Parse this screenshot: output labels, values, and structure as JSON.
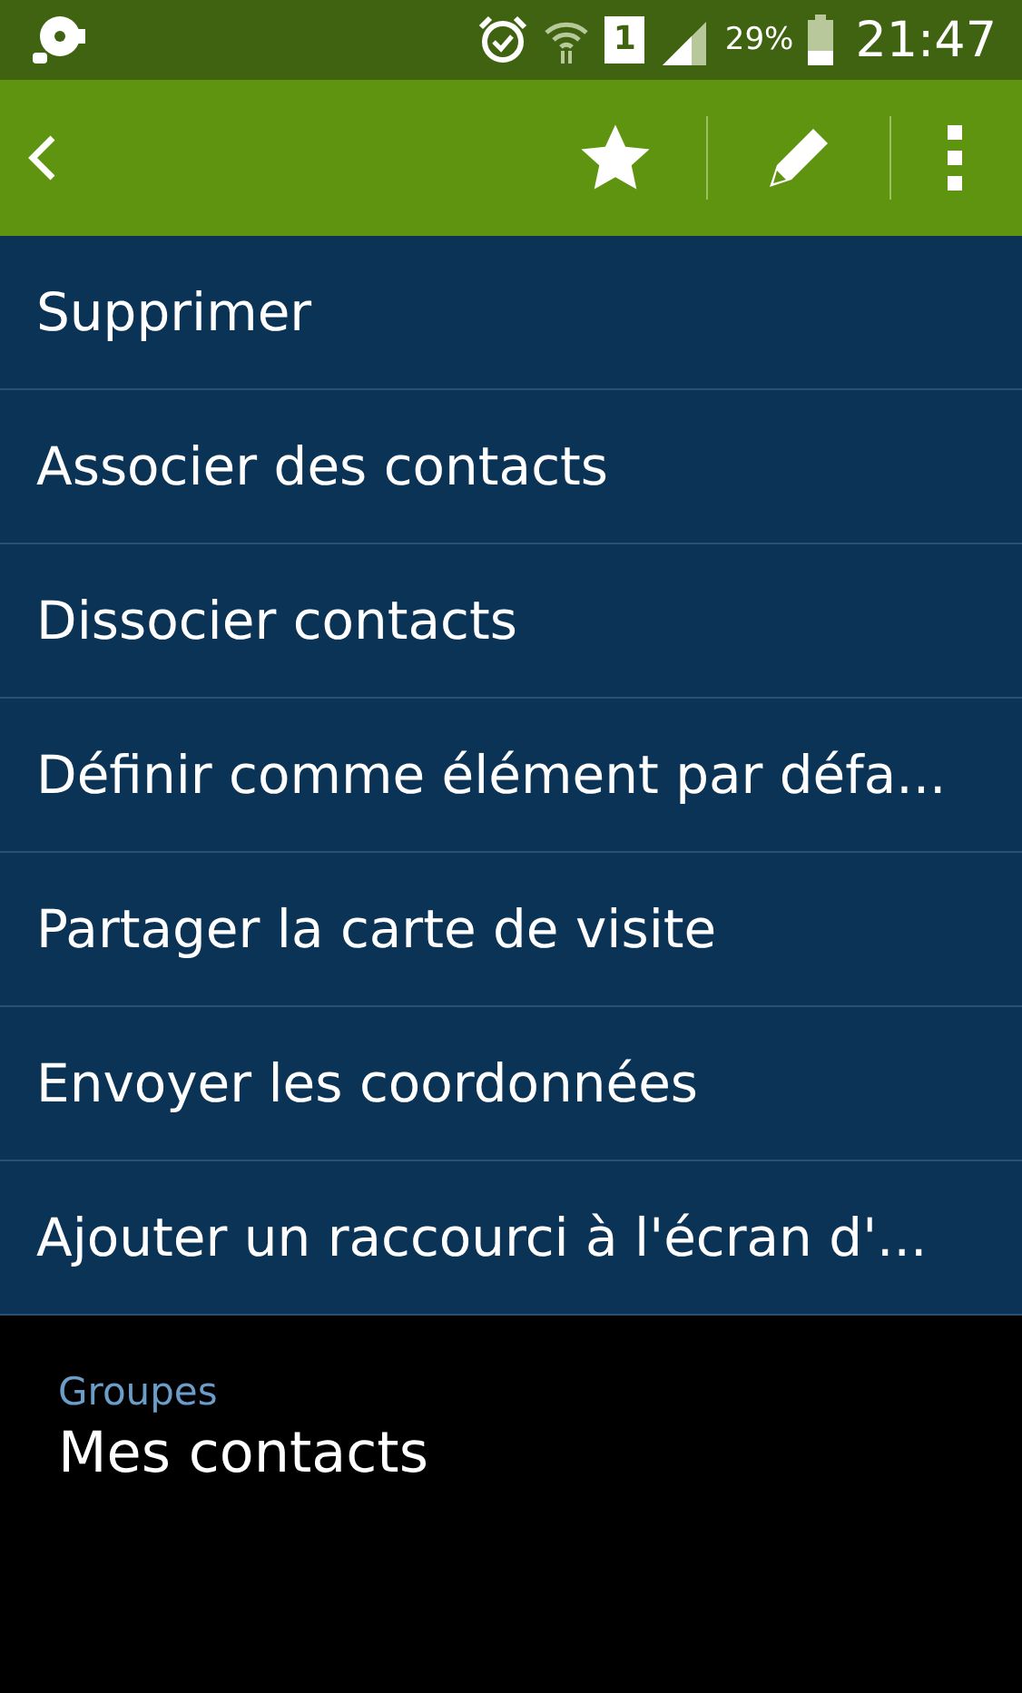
{
  "status_bar": {
    "battery": "29%",
    "time": "21:47",
    "sim": "1"
  },
  "menu": {
    "items": [
      {
        "label": "Supprimer"
      },
      {
        "label": "Associer des contacts"
      },
      {
        "label": "Dissocier contacts"
      },
      {
        "label": "Définir comme élément par défa..."
      },
      {
        "label": "Partager la carte de visite"
      },
      {
        "label": "Envoyer les coordonnées"
      },
      {
        "label": "Ajouter un raccourci à l'écran d'..."
      }
    ]
  },
  "groups": {
    "label": "Groupes",
    "value": "Mes contacts"
  }
}
